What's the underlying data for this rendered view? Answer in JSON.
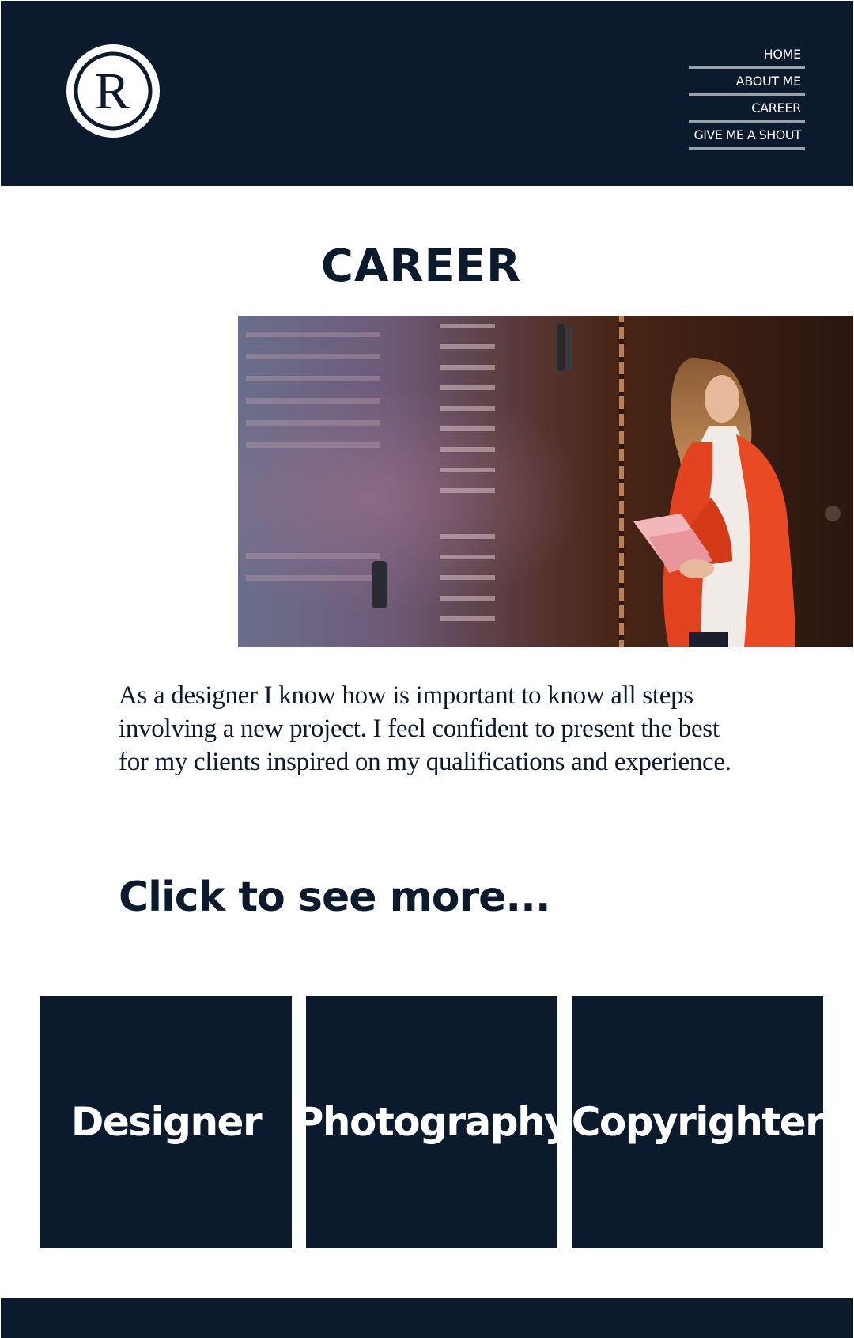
{
  "header": {
    "logo": {
      "letter": "R",
      "icon": "registered-r-logo"
    },
    "nav": [
      {
        "label": "HOME"
      },
      {
        "label": "ABOUT ME"
      },
      {
        "label": "CAREER"
      },
      {
        "label": "GIVE ME A SHOUT"
      }
    ]
  },
  "main": {
    "title": "CAREER",
    "hero_image": {
      "icon": "woman-reading-photo"
    },
    "intro": "As a designer I know how is important to know all steps involving a new project. I feel confident to present the best for my clients inspired on my qualifications and experience.",
    "more_heading": "Click to see more...",
    "tiles": [
      {
        "label": "Designer"
      },
      {
        "label": "Photography"
      },
      {
        "label": "Copyrighter"
      }
    ]
  },
  "colors": {
    "navy": "#0c1a2e",
    "white": "#ffffff",
    "nav_divider": "#9aa1a9"
  }
}
